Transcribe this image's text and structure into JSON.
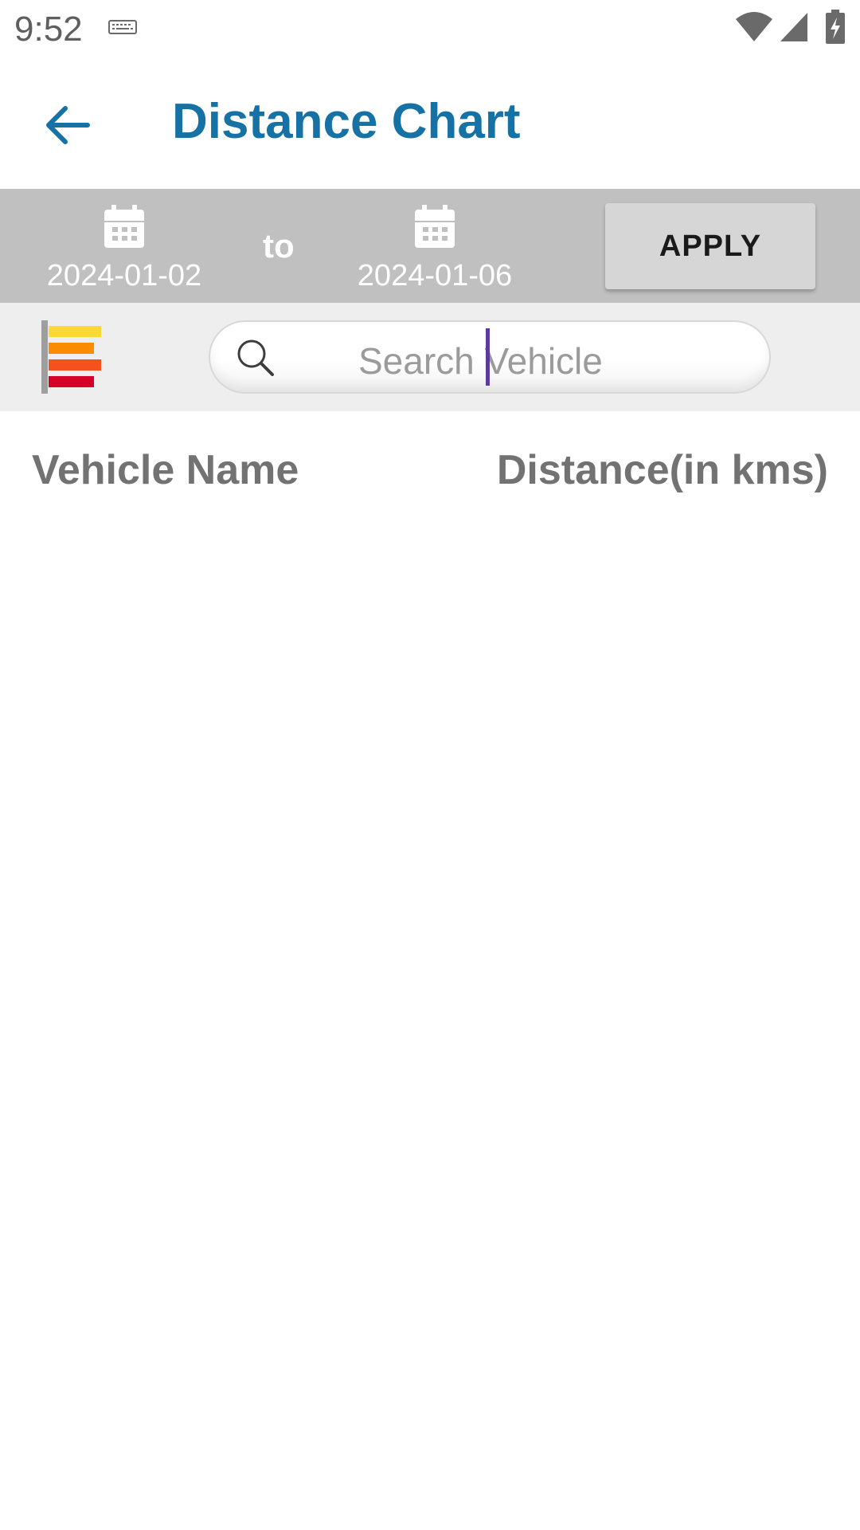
{
  "status_bar": {
    "time": "9:52",
    "icons": [
      "keyboard-icon",
      "wifi-icon",
      "signal-icon",
      "battery-charging-icon"
    ]
  },
  "app_bar": {
    "title": "Distance Chart",
    "back_icon": "arrow-left-icon",
    "title_color": "#1672a4"
  },
  "date_range": {
    "from_date": "2024-01-02",
    "separator": "to",
    "to_date": "2024-01-06",
    "apply_label": "APPLY",
    "calendar_icon": "calendar-icon"
  },
  "search": {
    "placeholder": "Search Vehicle",
    "chart_icon": "bar-chart-icon"
  },
  "table": {
    "columns": [
      "Vehicle Name",
      "Distance(in kms)"
    ],
    "rows": []
  },
  "colors": {
    "date_bar_bg": "#c0c0c0",
    "search_row_bg": "#eeeeee",
    "header_text": "#727272"
  }
}
